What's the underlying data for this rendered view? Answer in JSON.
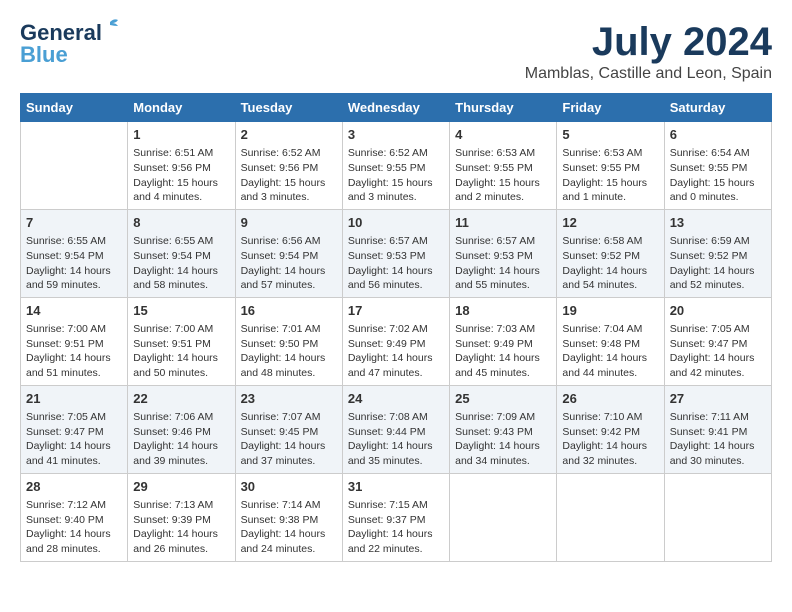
{
  "logo": {
    "line1": "General",
    "line2": "Blue"
  },
  "title": {
    "month_year": "July 2024",
    "location": "Mamblas, Castille and Leon, Spain"
  },
  "days_of_week": [
    "Sunday",
    "Monday",
    "Tuesday",
    "Wednesday",
    "Thursday",
    "Friday",
    "Saturday"
  ],
  "weeks": [
    [
      {
        "day": "",
        "content": ""
      },
      {
        "day": "1",
        "content": "Sunrise: 6:51 AM\nSunset: 9:56 PM\nDaylight: 15 hours\nand 4 minutes."
      },
      {
        "day": "2",
        "content": "Sunrise: 6:52 AM\nSunset: 9:56 PM\nDaylight: 15 hours\nand 3 minutes."
      },
      {
        "day": "3",
        "content": "Sunrise: 6:52 AM\nSunset: 9:55 PM\nDaylight: 15 hours\nand 3 minutes."
      },
      {
        "day": "4",
        "content": "Sunrise: 6:53 AM\nSunset: 9:55 PM\nDaylight: 15 hours\nand 2 minutes."
      },
      {
        "day": "5",
        "content": "Sunrise: 6:53 AM\nSunset: 9:55 PM\nDaylight: 15 hours\nand 1 minute."
      },
      {
        "day": "6",
        "content": "Sunrise: 6:54 AM\nSunset: 9:55 PM\nDaylight: 15 hours\nand 0 minutes."
      }
    ],
    [
      {
        "day": "7",
        "content": "Sunrise: 6:55 AM\nSunset: 9:54 PM\nDaylight: 14 hours\nand 59 minutes."
      },
      {
        "day": "8",
        "content": "Sunrise: 6:55 AM\nSunset: 9:54 PM\nDaylight: 14 hours\nand 58 minutes."
      },
      {
        "day": "9",
        "content": "Sunrise: 6:56 AM\nSunset: 9:54 PM\nDaylight: 14 hours\nand 57 minutes."
      },
      {
        "day": "10",
        "content": "Sunrise: 6:57 AM\nSunset: 9:53 PM\nDaylight: 14 hours\nand 56 minutes."
      },
      {
        "day": "11",
        "content": "Sunrise: 6:57 AM\nSunset: 9:53 PM\nDaylight: 14 hours\nand 55 minutes."
      },
      {
        "day": "12",
        "content": "Sunrise: 6:58 AM\nSunset: 9:52 PM\nDaylight: 14 hours\nand 54 minutes."
      },
      {
        "day": "13",
        "content": "Sunrise: 6:59 AM\nSunset: 9:52 PM\nDaylight: 14 hours\nand 52 minutes."
      }
    ],
    [
      {
        "day": "14",
        "content": "Sunrise: 7:00 AM\nSunset: 9:51 PM\nDaylight: 14 hours\nand 51 minutes."
      },
      {
        "day": "15",
        "content": "Sunrise: 7:00 AM\nSunset: 9:51 PM\nDaylight: 14 hours\nand 50 minutes."
      },
      {
        "day": "16",
        "content": "Sunrise: 7:01 AM\nSunset: 9:50 PM\nDaylight: 14 hours\nand 48 minutes."
      },
      {
        "day": "17",
        "content": "Sunrise: 7:02 AM\nSunset: 9:49 PM\nDaylight: 14 hours\nand 47 minutes."
      },
      {
        "day": "18",
        "content": "Sunrise: 7:03 AM\nSunset: 9:49 PM\nDaylight: 14 hours\nand 45 minutes."
      },
      {
        "day": "19",
        "content": "Sunrise: 7:04 AM\nSunset: 9:48 PM\nDaylight: 14 hours\nand 44 minutes."
      },
      {
        "day": "20",
        "content": "Sunrise: 7:05 AM\nSunset: 9:47 PM\nDaylight: 14 hours\nand 42 minutes."
      }
    ],
    [
      {
        "day": "21",
        "content": "Sunrise: 7:05 AM\nSunset: 9:47 PM\nDaylight: 14 hours\nand 41 minutes."
      },
      {
        "day": "22",
        "content": "Sunrise: 7:06 AM\nSunset: 9:46 PM\nDaylight: 14 hours\nand 39 minutes."
      },
      {
        "day": "23",
        "content": "Sunrise: 7:07 AM\nSunset: 9:45 PM\nDaylight: 14 hours\nand 37 minutes."
      },
      {
        "day": "24",
        "content": "Sunrise: 7:08 AM\nSunset: 9:44 PM\nDaylight: 14 hours\nand 35 minutes."
      },
      {
        "day": "25",
        "content": "Sunrise: 7:09 AM\nSunset: 9:43 PM\nDaylight: 14 hours\nand 34 minutes."
      },
      {
        "day": "26",
        "content": "Sunrise: 7:10 AM\nSunset: 9:42 PM\nDaylight: 14 hours\nand 32 minutes."
      },
      {
        "day": "27",
        "content": "Sunrise: 7:11 AM\nSunset: 9:41 PM\nDaylight: 14 hours\nand 30 minutes."
      }
    ],
    [
      {
        "day": "28",
        "content": "Sunrise: 7:12 AM\nSunset: 9:40 PM\nDaylight: 14 hours\nand 28 minutes."
      },
      {
        "day": "29",
        "content": "Sunrise: 7:13 AM\nSunset: 9:39 PM\nDaylight: 14 hours\nand 26 minutes."
      },
      {
        "day": "30",
        "content": "Sunrise: 7:14 AM\nSunset: 9:38 PM\nDaylight: 14 hours\nand 24 minutes."
      },
      {
        "day": "31",
        "content": "Sunrise: 7:15 AM\nSunset: 9:37 PM\nDaylight: 14 hours\nand 22 minutes."
      },
      {
        "day": "",
        "content": ""
      },
      {
        "day": "",
        "content": ""
      },
      {
        "day": "",
        "content": ""
      }
    ]
  ]
}
